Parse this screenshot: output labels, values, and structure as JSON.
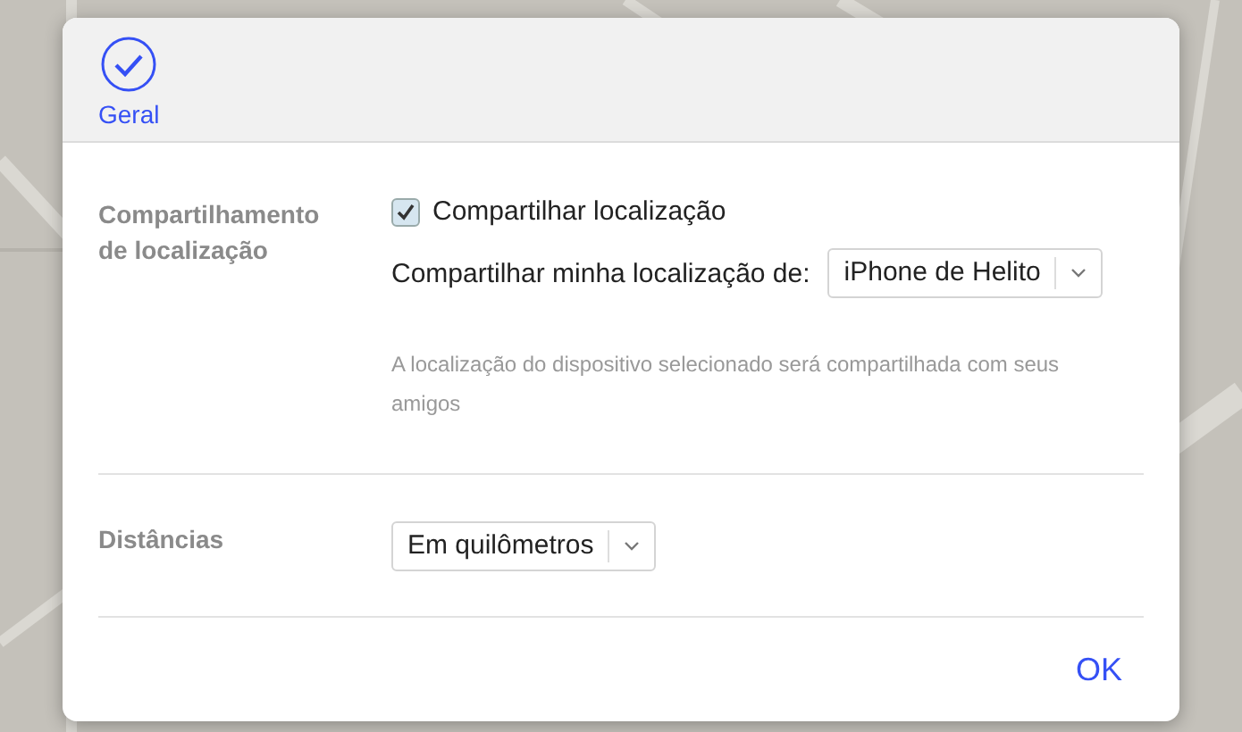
{
  "toolbar": {
    "tabs": [
      {
        "label": "Geral",
        "selected": true
      }
    ]
  },
  "sections": [
    {
      "label": "Compartilhamento\nde localização",
      "share_checkbox": {
        "label": "Compartilhar localização",
        "checked": true
      },
      "device_select": {
        "label": "Compartilhar minha localização de:",
        "value": "iPhone de Helito"
      },
      "hint": "A localização do dispositivo selecionado será compartilhada com seus amigos"
    },
    {
      "label": "Distâncias",
      "units_select": {
        "value": "Em quilômetros"
      }
    }
  ],
  "buttons": [
    {
      "label": "OK"
    }
  ]
}
